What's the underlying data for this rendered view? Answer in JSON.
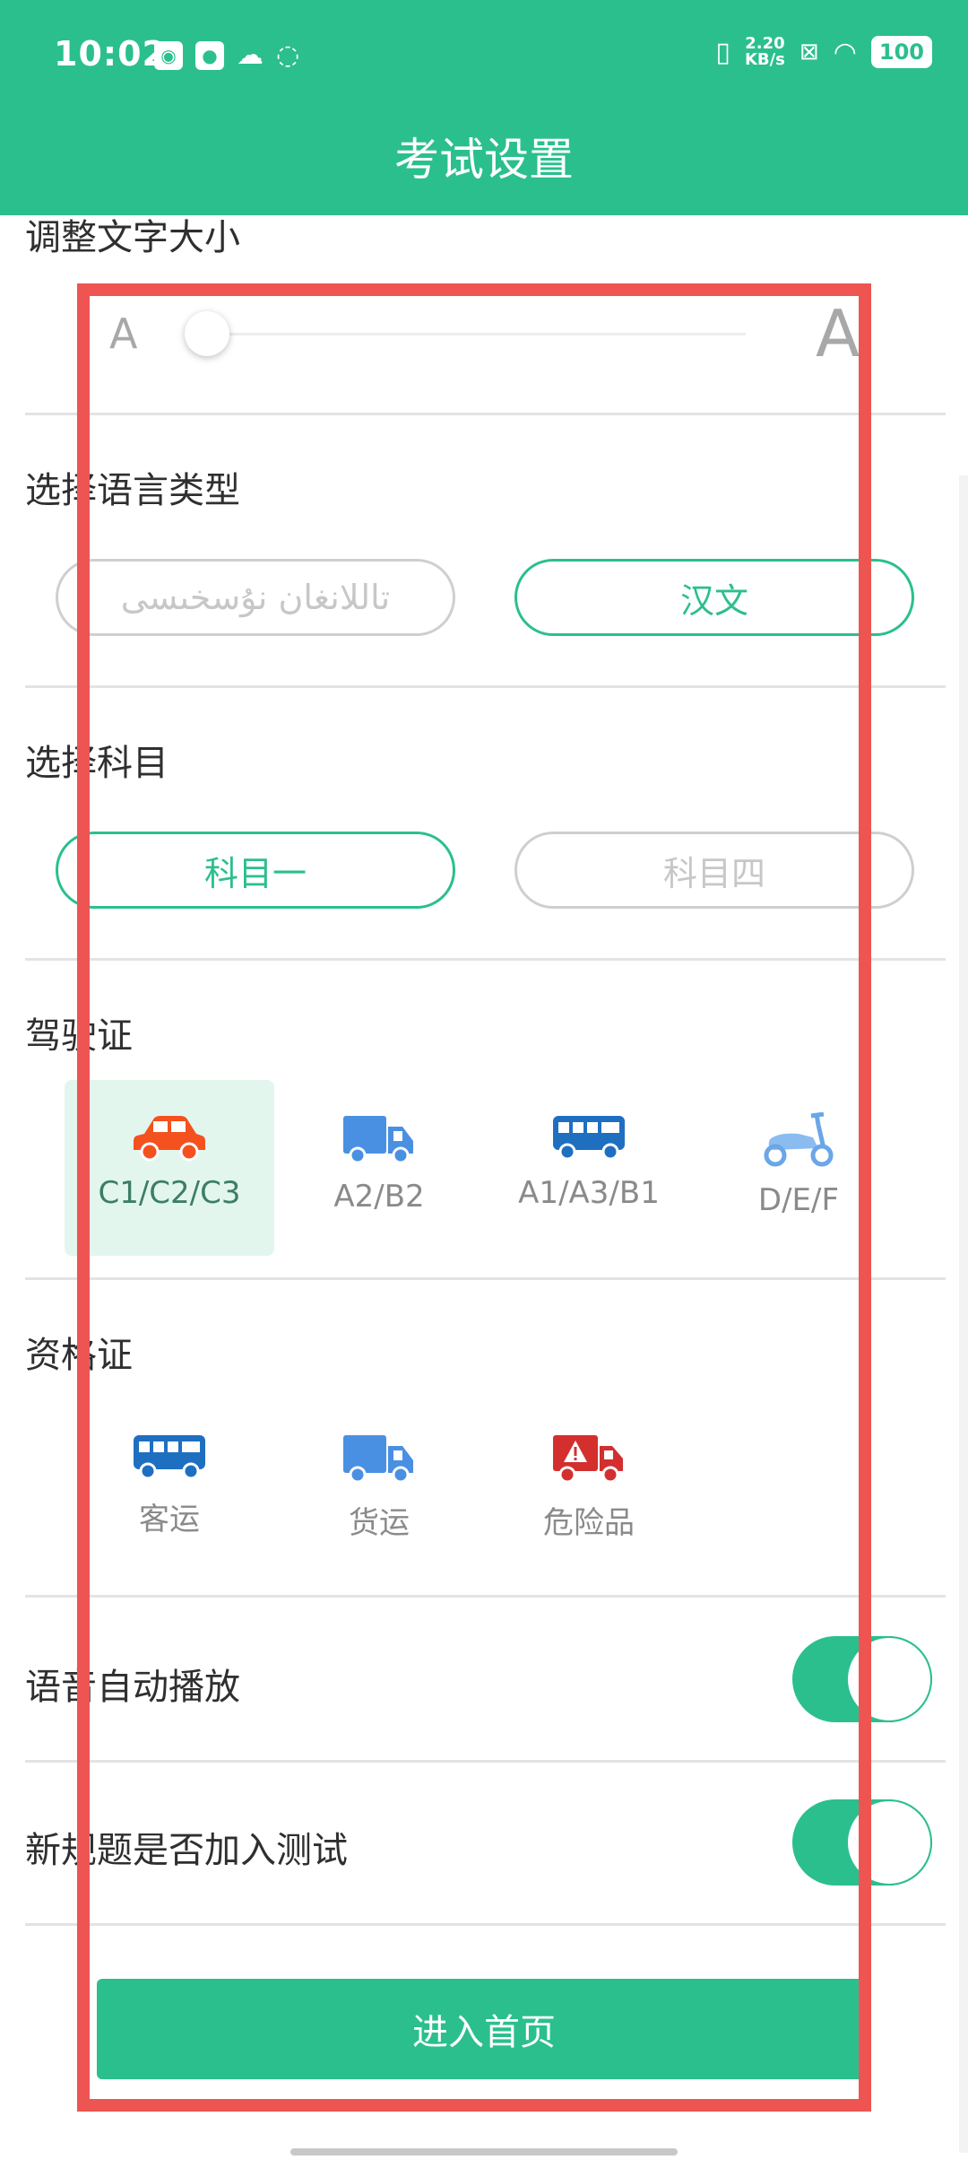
{
  "status_bar": {
    "time": "10:02",
    "net_speed_value": "2.20",
    "net_speed_unit": "KB/s",
    "battery": "100"
  },
  "header": {
    "title": "考试设置"
  },
  "font_size": {
    "label": "调整文字大小",
    "small_a": "A",
    "large_a": "A",
    "level": 0
  },
  "language": {
    "label": "选择语言类型",
    "options": [
      {
        "label": "تاللانغان نۇسخىسى",
        "selected": false
      },
      {
        "label": "汉文",
        "selected": true
      }
    ]
  },
  "subject": {
    "label": "选择科目",
    "options": [
      {
        "label": "科目一",
        "selected": true
      },
      {
        "label": "科目四",
        "selected": false
      }
    ]
  },
  "license": {
    "label": "驾驶证",
    "options": [
      {
        "label": "C1/C2/C3",
        "icon": "car-icon",
        "color": "#f4511e",
        "selected": true
      },
      {
        "label": "A2/B2",
        "icon": "truck-icon",
        "color": "#4a90e2",
        "selected": false
      },
      {
        "label": "A1/A3/B1",
        "icon": "bus-icon",
        "color": "#1f6fc1",
        "selected": false
      },
      {
        "label": "D/E/F",
        "icon": "scooter-icon",
        "color": "#6aa6e8",
        "selected": false
      }
    ]
  },
  "qualification": {
    "label": "资格证",
    "options": [
      {
        "label": "客运",
        "icon": "bus-icon",
        "color": "#1f6fc1"
      },
      {
        "label": "货运",
        "icon": "truck-icon",
        "color": "#4a90e2"
      },
      {
        "label": "危险品",
        "icon": "hazard-truck-icon",
        "color": "#d32f2f"
      }
    ]
  },
  "toggles": {
    "autoplay": {
      "label": "语音自动播放",
      "on": true
    },
    "new_rules": {
      "label": "新规题是否加入测试",
      "on": true
    }
  },
  "enter_button": {
    "label": "进入首页"
  },
  "colors": {
    "accent": "#2bbf8e",
    "highlight": "#ee5552"
  }
}
